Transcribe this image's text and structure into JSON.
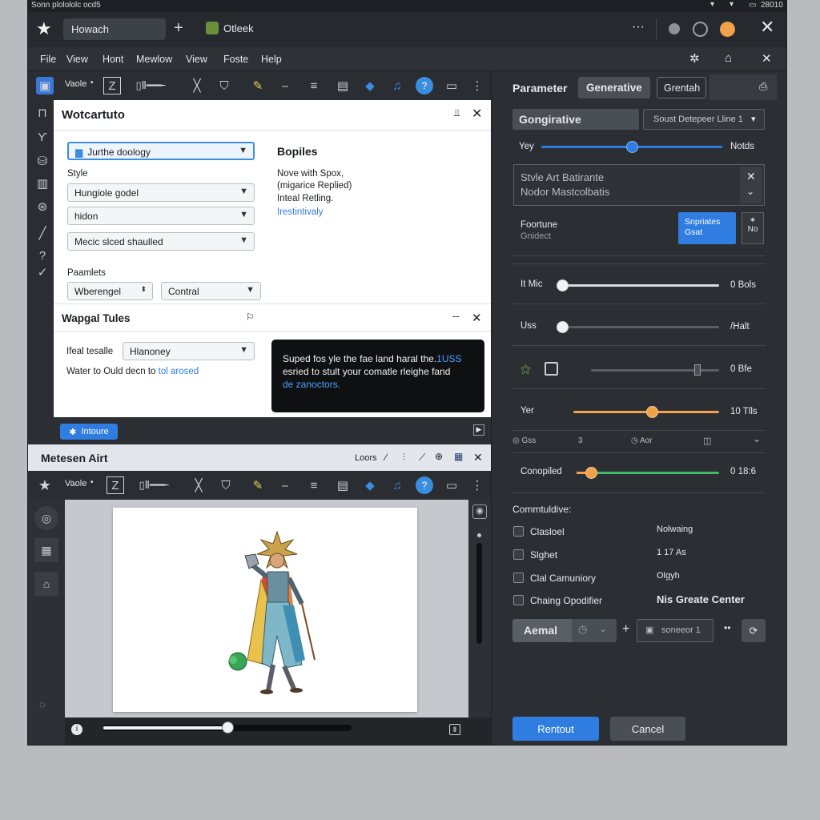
{
  "system": {
    "title": "Sonn plolololc ocd5",
    "clock": "28010"
  },
  "titlebar": {
    "tab_label": "Howach",
    "app_label": "Otleek"
  },
  "menu": [
    "File",
    "View",
    "Hont",
    "Mewlow",
    "View",
    "Foste",
    "Help"
  ],
  "toolbar": {
    "mode_label": "Vaole"
  },
  "dialog1": {
    "title": "Wotcartuto",
    "preset_select": "Jurthe doology",
    "style_label": "Style",
    "style_select_1": "Hungiole godel",
    "style_select_2": "hidon",
    "style_select_3": "Mecic slced shaulled",
    "params_label": "Paamlets",
    "param_select_1": "Wberengel",
    "param_select_2": "Contral",
    "info_title": "Bopiles",
    "info_lines": [
      "Nove with Spox,",
      "(migarice Replied)",
      "Inteal Retling."
    ],
    "info_link": "Irestintivaly"
  },
  "dialog2": {
    "title": "Wapgal Tules",
    "field_label": "Ifeal tesalle",
    "field_select": "Hlanoney",
    "help_text": "Water to Ould decn to",
    "help_link": "tol arosed",
    "tooltip_text": "Suped fos yle the fae land haral the.",
    "tooltip_accent": "1USS",
    "tooltip_line2": "esried to stult your comatle rleighe fand",
    "tooltip_link": "de zanoctors."
  },
  "install_button": "Intoure",
  "preview": {
    "title": "Metesen Airt",
    "loops_label": "Loors",
    "mode_label": "Vaole",
    "scrub_progress": 0.5
  },
  "right_panel": {
    "tabs": [
      "Parameter",
      "Generative",
      "Grentah"
    ],
    "section_title": "Gongirative",
    "section_select": "Soust Detepeer Lline 1",
    "slider_yey": {
      "label": "Yey",
      "value_label": "Notds",
      "value": 0.5
    },
    "text_area_line1": "Stvle Art Batirante",
    "text_area_line2": "Nodor Mastcolbatis",
    "feature_label": "Foortune",
    "feature_sub": "Gnidect",
    "feature_button": "Snpriates Gsat",
    "feature_side": "No",
    "sliders": [
      {
        "label": "It Mic",
        "value_label": "0 Bols",
        "value": 0.0,
        "color": "#d8dade"
      },
      {
        "label": "Uss",
        "value_label": "/Halt",
        "value": 0.0,
        "color": "#5a5f66"
      },
      {
        "label": "",
        "value_label": "0 Bfe",
        "value": 0.83,
        "color": "#5a5f66"
      },
      {
        "label": "Yer",
        "value_label": "10 Tlls",
        "value": 0.54,
        "color": "#f0a24a"
      }
    ],
    "stats_row": {
      "a": "Gss",
      "b": "3",
      "c": "Aor"
    },
    "completed": {
      "label": "Conopiled",
      "value_label": "0 18:6",
      "value": 0.1,
      "color": "#3fb96b"
    },
    "commit_title": "Commtuldive:",
    "checklist": [
      {
        "label": "Clasloel",
        "value": "Nolwaing"
      },
      {
        "label": "Slghet",
        "value": "1 17 As"
      },
      {
        "label": "Clal Camuniory",
        "value": "Olgyh"
      },
      {
        "label": "Chaing Opodifier",
        "value": "Nis Greate Center"
      }
    ],
    "action_select": "Aemal",
    "counter_field": "soneeor 1",
    "primary_button": "Rentout",
    "cancel_button": "Cancel"
  },
  "colors": {
    "accent": "#2f7de1",
    "orange": "#f0a24a",
    "green": "#3fb96b",
    "panel": "#2b2e33"
  }
}
